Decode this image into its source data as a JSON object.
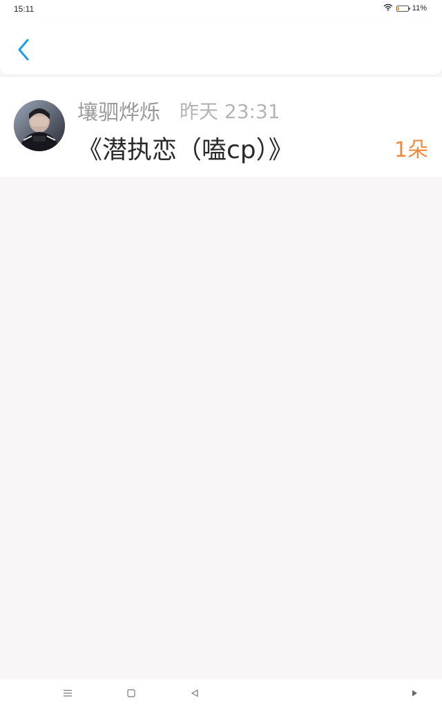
{
  "status_bar": {
    "time": "15:11",
    "battery_text": "11%",
    "battery_level": 0.11,
    "icons": [
      "wifi-icon",
      "battery-icon"
    ]
  },
  "top_nav": {
    "back_icon": "chevron-left-icon",
    "accent_color": "#1e9bf0"
  },
  "post": {
    "author": "壤驷烨烁",
    "time": "昨天 23:31",
    "title": "《潜执恋（嗑cp）》",
    "flowers": "1朵",
    "flowers_color": "#ef8a3c"
  },
  "bottom_nav": {
    "icons": [
      "menu-icon",
      "home-square-icon",
      "back-triangle-icon",
      "play-icon"
    ]
  }
}
